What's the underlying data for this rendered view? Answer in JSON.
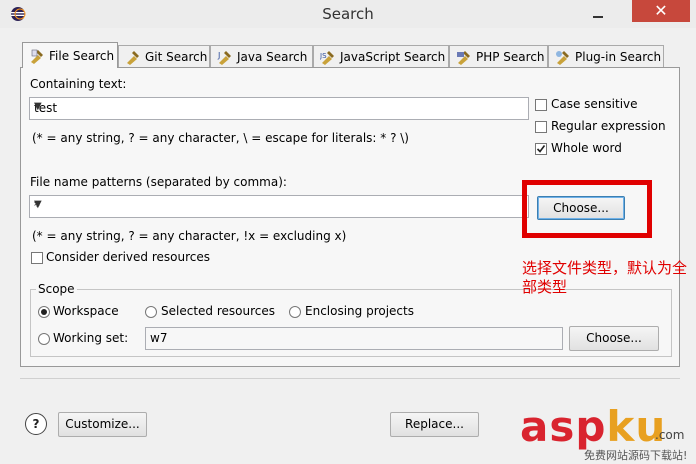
{
  "window": {
    "title": "Search",
    "close_glyph": "✕"
  },
  "tabs": [
    {
      "label": "File Search",
      "active": true
    },
    {
      "label": "Git Search"
    },
    {
      "label": "Java Search"
    },
    {
      "label": "JavaScript Search"
    },
    {
      "label": "PHP Search"
    },
    {
      "label": "Plug-in Search"
    }
  ],
  "containing_text": {
    "label": "Containing text:",
    "value": "test",
    "hint": "(* = any string, ? = any character, \\ = escape for literals: * ? \\)"
  },
  "options": {
    "case_sensitive": {
      "label": "Case sensitive",
      "checked": false
    },
    "regex": {
      "label": "Regular expression",
      "checked": false
    },
    "whole_word": {
      "label": "Whole word",
      "checked": true
    }
  },
  "file_patterns": {
    "label": "File name patterns (separated by comma):",
    "value": "*",
    "hint": "(* = any string, ? = any character, !x = excluding x)",
    "choose_label": "Choose..."
  },
  "derived": {
    "label": "Consider derived resources",
    "checked": false
  },
  "scope": {
    "legend": "Scope",
    "workspace": "Workspace",
    "selected": "Selected resources",
    "enclosing": "Enclosing projects",
    "working_set": "Working set:",
    "working_set_value": "w7",
    "choose_label": "Choose...",
    "selected_option": "Workspace"
  },
  "annotation": "选择文件类型，默认为全部类型",
  "footer": {
    "help": "?",
    "customize": "Customize...",
    "replace": "Replace..."
  },
  "watermark": {
    "main_a": "asp",
    "main_b": "ku",
    "com": ".com",
    "sub": "免费网站源码下载站!"
  },
  "colors": {
    "highlight": "#e00000",
    "close": "#c7483c"
  }
}
